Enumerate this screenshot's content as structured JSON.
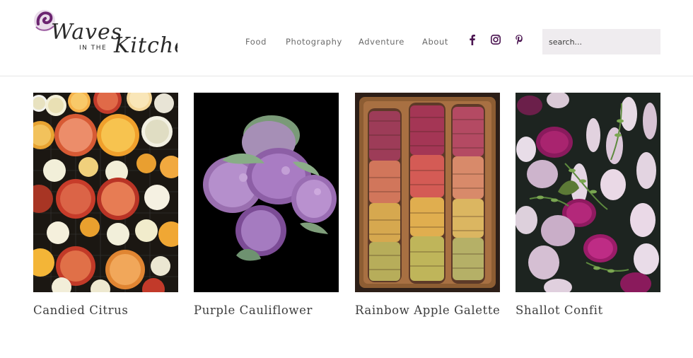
{
  "brand": {
    "name_top": "Waves",
    "name_mid": "IN THE",
    "name_bottom": "Kitchen",
    "logo_icon": "purple-wave-swirl",
    "accent": "#6b2470"
  },
  "nav": {
    "items": [
      {
        "label": "Food"
      },
      {
        "label": "Photography"
      },
      {
        "label": "Adventure"
      },
      {
        "label": "About"
      }
    ]
  },
  "social": {
    "color": "#4a1450",
    "icons": [
      "facebook-icon",
      "instagram-icon",
      "pinterest-icon"
    ]
  },
  "search": {
    "placeholder": "search..."
  },
  "posts": [
    {
      "title": "Candied Citrus",
      "image": "citrus-slices-photo"
    },
    {
      "title": "Purple Cauliflower",
      "image": "purple-cauliflower-photo"
    },
    {
      "title": "Rainbow Apple Galette",
      "image": "apple-galette-photo"
    },
    {
      "title": "Shallot Confit",
      "image": "shallot-confit-photo"
    }
  ]
}
